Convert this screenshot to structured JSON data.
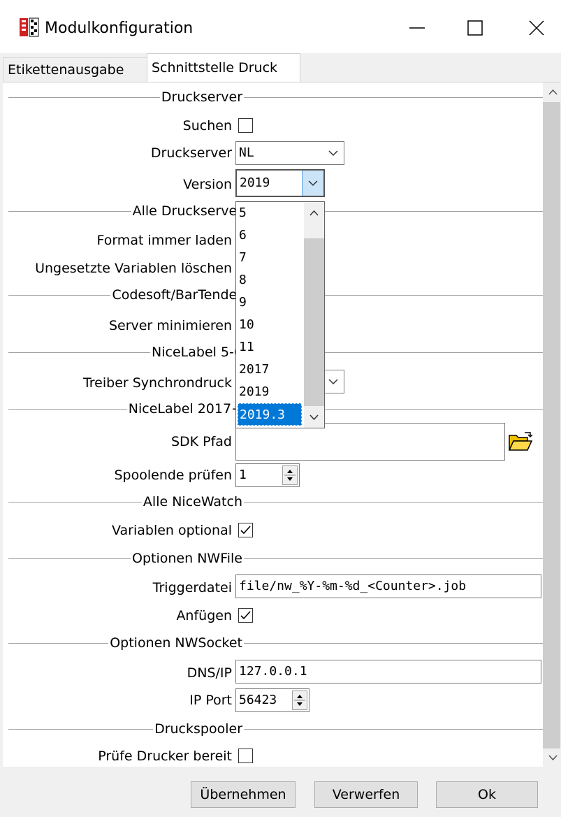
{
  "window": {
    "title": "Modulkonfiguration",
    "minimize_icon": "minimize-icon",
    "maximize_icon": "maximize-icon",
    "close_icon": "close-icon"
  },
  "tabs": [
    {
      "label": "Etikettenausgabe",
      "active": false
    },
    {
      "label": "Schnittstelle Druck",
      "active": true
    }
  ],
  "sections": {
    "druckserver": "Druckserver",
    "alle_druckserver": "Alle Druckserver",
    "codesoft": "Codesoft/BarTender",
    "nicelabel56": "NiceLabel 5-6",
    "nicelabel2017": "NiceLabel 2017+",
    "alle_nicewatch": "Alle NiceWatch",
    "nwfile": "Optionen NWFile",
    "nwsocket": "Optionen NWSocket",
    "druckspooler": "Druckspooler"
  },
  "fields": {
    "suchen_label": "Suchen",
    "druckserver_label": "Druckserver",
    "druckserver_value": "NL",
    "version_label": "Version",
    "version_value": "2019",
    "format_label": "Format immer laden",
    "ungesetzte_label": "Ungesetzte Variablen löschen",
    "server_min_label": "Server minimieren",
    "treiber_label": "Treiber Synchrondruck",
    "sdk_label": "SDK Pfad",
    "sdk_value": "",
    "spoolende_label": "Spoolende prüfen",
    "spoolende_value": "1",
    "variablen_label": "Variablen optional",
    "triggerdatei_label": "Triggerdatei",
    "triggerdatei_value": "file/nw_%Y-%m-%d_<Counter>.job",
    "anfuegen_label": "Anfügen",
    "dns_label": "DNS/IP",
    "dns_value": "127.0.0.1",
    "port_label": "IP Port",
    "port_value": "56423",
    "pruefe_label": "Prüfe Drucker bereit"
  },
  "version_options": [
    "5",
    "6",
    "7",
    "8",
    "9",
    "10",
    "11",
    "2017",
    "2019",
    "2019.3"
  ],
  "version_selected": "2019.3",
  "buttons": {
    "apply": "Übernehmen",
    "discard": "Verwerfen",
    "ok": "Ok"
  },
  "icons": {
    "app": "print-app-icon",
    "folder": "folder-open-icon",
    "check": "checkmark-icon"
  },
  "colors": {
    "selection": "#0078d7",
    "folder": "#f0c000"
  }
}
